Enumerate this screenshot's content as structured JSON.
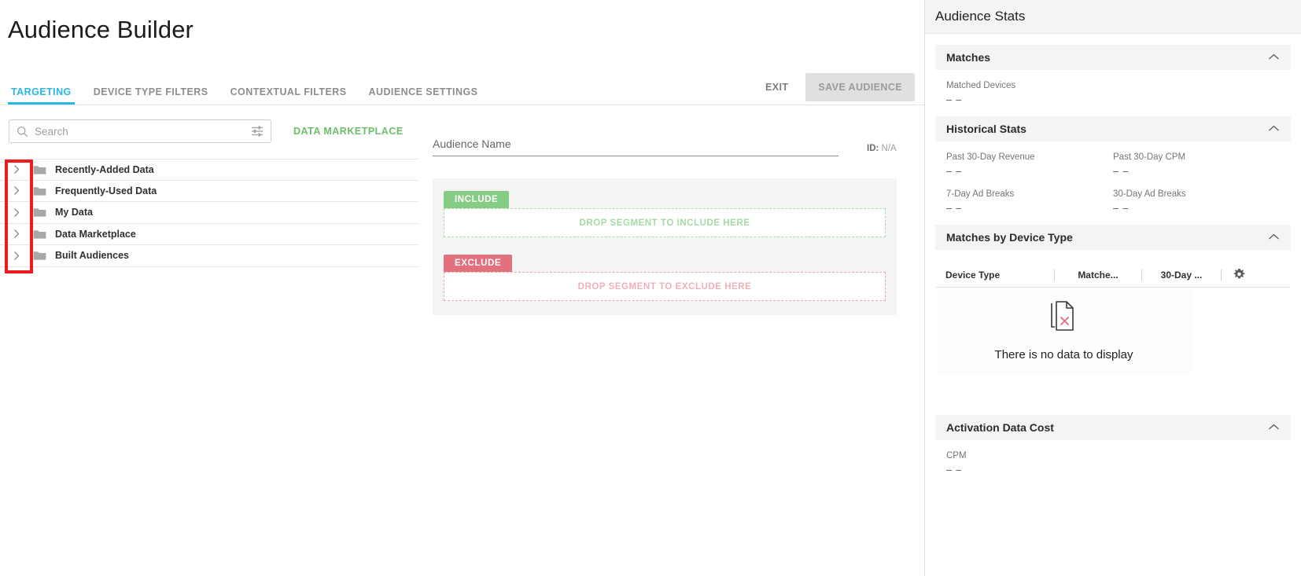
{
  "header": {
    "title": "Audience Builder",
    "tabs": [
      {
        "label": "TARGETING",
        "active": true
      },
      {
        "label": "DEVICE TYPE FILTERS",
        "active": false
      },
      {
        "label": "CONTEXTUAL FILTERS",
        "active": false
      },
      {
        "label": "AUDIENCE SETTINGS",
        "active": false
      }
    ],
    "exit_label": "EXIT",
    "save_label": "SAVE AUDIENCE"
  },
  "explorer": {
    "search_placeholder": "Search",
    "search_value": "",
    "search_icon": "search-icon",
    "filter_icon": "filter-sliders-icon",
    "marketplace_link": "DATA MARKETPLACE",
    "tree_items": [
      {
        "label": "Recently-Added Data",
        "icon": "folder-icon",
        "expand_icon": "chevron-right-icon"
      },
      {
        "label": "Frequently-Used Data",
        "icon": "folder-icon",
        "expand_icon": "chevron-right-icon"
      },
      {
        "label": "My Data",
        "icon": "folder-icon",
        "expand_icon": "chevron-right-icon"
      },
      {
        "label": "Data Marketplace",
        "icon": "folder-icon",
        "expand_icon": "chevron-right-icon"
      },
      {
        "label": "Built Audiences",
        "icon": "folder-icon",
        "expand_icon": "chevron-right-icon"
      }
    ]
  },
  "annotation": {
    "color": "#ee1c1c"
  },
  "audience": {
    "name_placeholder": "Audience Name",
    "name_value": "",
    "id_label": "ID:",
    "id_value": "N/A",
    "include": {
      "chip": "INCLUDE",
      "drop_text": "DROP SEGMENT TO INCLUDE HERE",
      "color": "#85cd85"
    },
    "exclude": {
      "chip": "EXCLUDE",
      "drop_text": "DROP SEGMENT TO EXCLUDE HERE",
      "color": "#e2707f"
    }
  },
  "stats": {
    "title": "Audience Stats",
    "collapse_icon": "chevron-up-icon",
    "matches": {
      "title": "Matches",
      "label": "Matched Devices",
      "value": "– –"
    },
    "historical": {
      "title": "Historical Stats",
      "items": [
        {
          "label": "Past 30-Day Revenue",
          "value": "– –"
        },
        {
          "label": "Past 30-Day CPM",
          "value": "– –"
        },
        {
          "label": "7-Day Ad Breaks",
          "value": "– –"
        },
        {
          "label": "30-Day Ad Breaks",
          "value": "– –"
        }
      ]
    },
    "device_type": {
      "title": "Matches by Device Type",
      "columns": [
        "Device Type",
        "Matche...",
        "30-Day ..."
      ],
      "settings_icon": "gear-icon",
      "empty_icon": "no-data-document-icon",
      "empty_text": "There is no data to display"
    },
    "activation": {
      "title": "Activation Data Cost",
      "label": "CPM",
      "value": "– –"
    }
  }
}
